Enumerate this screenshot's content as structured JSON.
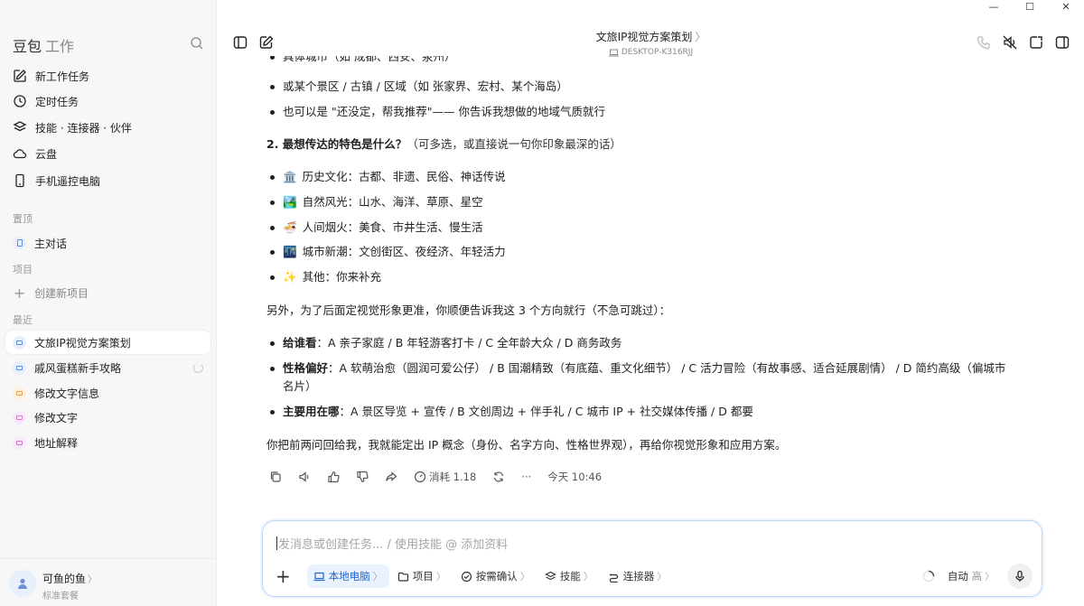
{
  "window": {
    "minimize": "—",
    "maximize": "☐",
    "close": "✕"
  },
  "sidebar": {
    "brand": "豆包",
    "brand_sub": "工作",
    "nav": [
      {
        "label": "新工作任务",
        "icon": "edit-icon"
      },
      {
        "label": "定时任务",
        "icon": "clock-icon"
      },
      {
        "label": "技能 · 连接器 · 伙伴",
        "icon": "layers-icon"
      },
      {
        "label": "云盘",
        "icon": "cloud-icon"
      },
      {
        "label": "手机遥控电脑",
        "icon": "phone-icon"
      }
    ],
    "pinned_label": "置顶",
    "pinned": [
      {
        "label": "主对话"
      }
    ],
    "projects_label": "项目",
    "create_project": "创建新项目",
    "recent_label": "最近",
    "recent": [
      {
        "label": "文旅IP视觉方案策划",
        "color": "#5b8fe8"
      },
      {
        "label": "戚风蛋糕新手攻略",
        "color": "#5b8fe8"
      },
      {
        "label": "修改文字信息",
        "color": "#f0a24a"
      },
      {
        "label": "修改文字",
        "color": "#d57bd6"
      },
      {
        "label": "地址解释",
        "color": "#d57bd6"
      }
    ],
    "user": {
      "name": "可鱼的鱼",
      "chevron": "〉",
      "plan": "标准套餐"
    }
  },
  "topbar": {
    "title": "文旅IP视觉方案策划",
    "title_chevron": "〉",
    "device": "DESKTOP-K316RJJ"
  },
  "message": {
    "cut_line": "具体城市（如 成都、西安、泉州）",
    "city_bullets": [
      "或某个景区 / 古镇 / 区域（如 张家界、宏村、某个海岛）",
      "也可以是 \"还没定，帮我推荐\"—— 你告诉我想做的地域气质就行"
    ],
    "q2_bold": "2. 最想传达的特色是什么？",
    "q2_rest": "（可多选，或直接说一句你印象最深的话）",
    "features": [
      {
        "emoji": "🏛️",
        "text": "历史文化：古都、非遗、民俗、神话传说"
      },
      {
        "emoji": "🏞️",
        "text": "自然风光：山水、海洋、草原、星空"
      },
      {
        "emoji": "🍜",
        "text": "人间烟火：美食、市井生活、慢生活"
      },
      {
        "emoji": "🌃",
        "text": "城市新潮：文创街区、夜经济、年轻活力"
      },
      {
        "emoji": "✨",
        "text": "其他：你来补充"
      }
    ],
    "also": "另外，为了后面定视觉形象更准，你顺便告诉我这 3 个方向就行（不急可跳过）：",
    "directions": [
      {
        "key": "给谁看",
        "text": "：A 亲子家庭 / B 年轻游客打卡 / C 全年龄大众 / D 商务政务"
      },
      {
        "key": "性格偏好",
        "text": "：A 软萌治愈（圆润可爱公仔） / B 国潮精致（有底蕴、重文化细节） / C 活力冒险（有故事感、适合延展剧情） / D 简约高级（偏城市名片）"
      },
      {
        "key": "主要用在哪",
        "text": "：A 景区导览 + 宣传 / B 文创周边 + 伴手礼 / C 城市 IP + 社交媒体传播 / D 都要"
      }
    ],
    "closing": "你把前两问回给我，我就能定出 IP 概念（身份、名字方向、性格世界观），再给你视觉形象和应用方案。",
    "actions": {
      "cost": "消耗 1.18",
      "more": "···",
      "time": "今天 10:46"
    }
  },
  "composer": {
    "placeholder": "发消息或创建任务... / 使用技能 @ 添加资料",
    "plus": "+",
    "tools": [
      {
        "label": "本地电脑",
        "active": true
      },
      {
        "label": "项目",
        "active": false
      },
      {
        "label": "按需确认",
        "active": false
      },
      {
        "label": "技能",
        "active": false
      },
      {
        "label": "连接器",
        "active": false
      }
    ],
    "chevron": "〉",
    "mode": "自动",
    "mode_level": "高",
    "accent": "#2463d6"
  }
}
